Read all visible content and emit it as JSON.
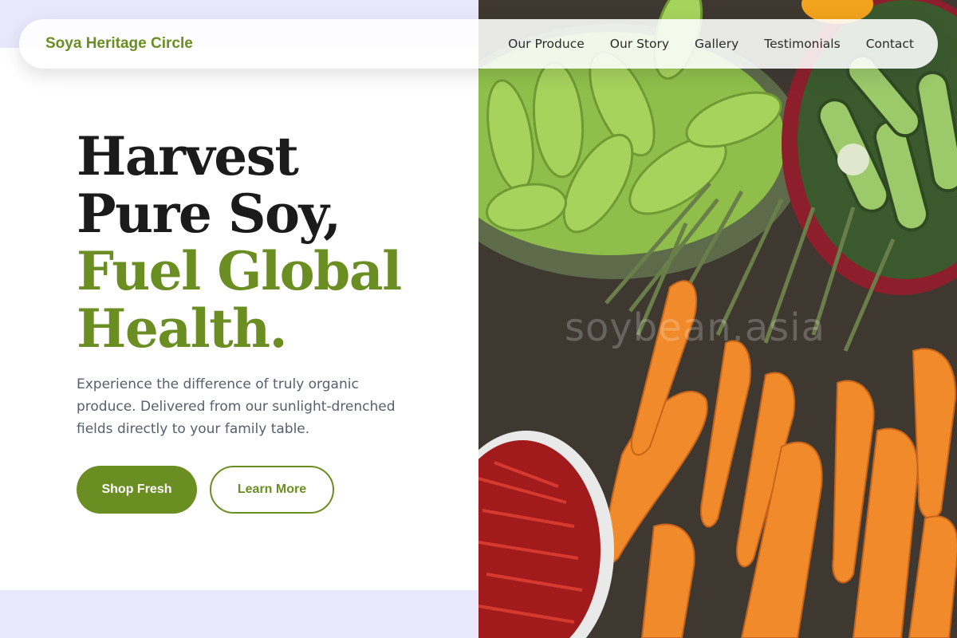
{
  "brand": "Soya Heritage Circle",
  "nav": {
    "items": [
      "Our Produce",
      "Our Story",
      "Gallery",
      "Testimonials",
      "Contact"
    ]
  },
  "hero": {
    "headline_line1": "Harvest",
    "headline_line2": "Pure Soy,",
    "headline_accent1": "Fuel Global",
    "headline_accent2": "Health.",
    "subtitle": "Experience the difference of truly organic produce. Delivered from our sunlight-drenched fields directly to your family table.",
    "primary_button": "Shop Fresh",
    "secondary_button": "Learn More",
    "image_watermark": "soybean.asia"
  },
  "colors": {
    "accent": "#6b8e23",
    "page_background": "#e9e7fb",
    "heading": "#1b1b1b",
    "body_text": "#555f6d"
  }
}
